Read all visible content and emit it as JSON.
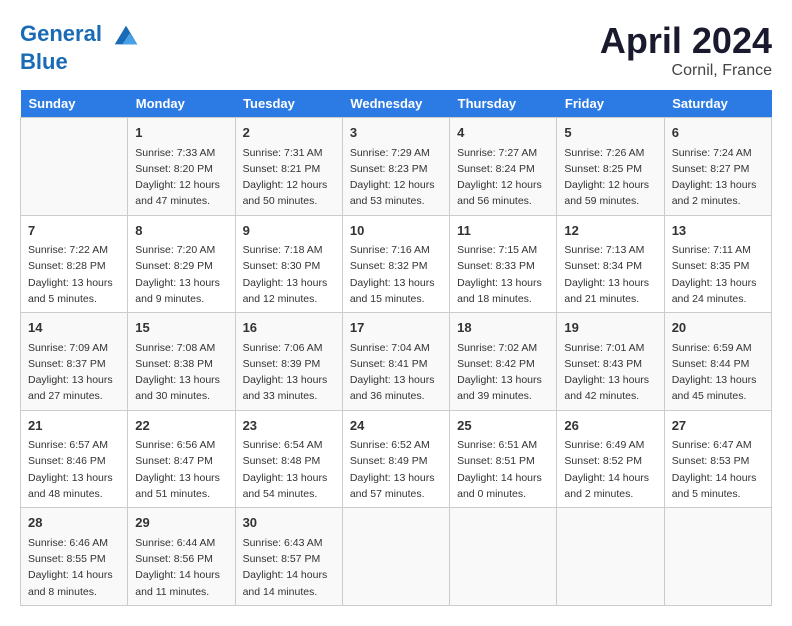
{
  "header": {
    "logo_line1": "General",
    "logo_line2": "Blue",
    "month": "April 2024",
    "location": "Cornil, France"
  },
  "days_of_week": [
    "Sunday",
    "Monday",
    "Tuesday",
    "Wednesday",
    "Thursday",
    "Friday",
    "Saturday"
  ],
  "weeks": [
    [
      {
        "day": "",
        "info": ""
      },
      {
        "day": "1",
        "info": "Sunrise: 7:33 AM\nSunset: 8:20 PM\nDaylight: 12 hours\nand 47 minutes."
      },
      {
        "day": "2",
        "info": "Sunrise: 7:31 AM\nSunset: 8:21 PM\nDaylight: 12 hours\nand 50 minutes."
      },
      {
        "day": "3",
        "info": "Sunrise: 7:29 AM\nSunset: 8:23 PM\nDaylight: 12 hours\nand 53 minutes."
      },
      {
        "day": "4",
        "info": "Sunrise: 7:27 AM\nSunset: 8:24 PM\nDaylight: 12 hours\nand 56 minutes."
      },
      {
        "day": "5",
        "info": "Sunrise: 7:26 AM\nSunset: 8:25 PM\nDaylight: 12 hours\nand 59 minutes."
      },
      {
        "day": "6",
        "info": "Sunrise: 7:24 AM\nSunset: 8:27 PM\nDaylight: 13 hours\nand 2 minutes."
      }
    ],
    [
      {
        "day": "7",
        "info": "Sunrise: 7:22 AM\nSunset: 8:28 PM\nDaylight: 13 hours\nand 5 minutes."
      },
      {
        "day": "8",
        "info": "Sunrise: 7:20 AM\nSunset: 8:29 PM\nDaylight: 13 hours\nand 9 minutes."
      },
      {
        "day": "9",
        "info": "Sunrise: 7:18 AM\nSunset: 8:30 PM\nDaylight: 13 hours\nand 12 minutes."
      },
      {
        "day": "10",
        "info": "Sunrise: 7:16 AM\nSunset: 8:32 PM\nDaylight: 13 hours\nand 15 minutes."
      },
      {
        "day": "11",
        "info": "Sunrise: 7:15 AM\nSunset: 8:33 PM\nDaylight: 13 hours\nand 18 minutes."
      },
      {
        "day": "12",
        "info": "Sunrise: 7:13 AM\nSunset: 8:34 PM\nDaylight: 13 hours\nand 21 minutes."
      },
      {
        "day": "13",
        "info": "Sunrise: 7:11 AM\nSunset: 8:35 PM\nDaylight: 13 hours\nand 24 minutes."
      }
    ],
    [
      {
        "day": "14",
        "info": "Sunrise: 7:09 AM\nSunset: 8:37 PM\nDaylight: 13 hours\nand 27 minutes."
      },
      {
        "day": "15",
        "info": "Sunrise: 7:08 AM\nSunset: 8:38 PM\nDaylight: 13 hours\nand 30 minutes."
      },
      {
        "day": "16",
        "info": "Sunrise: 7:06 AM\nSunset: 8:39 PM\nDaylight: 13 hours\nand 33 minutes."
      },
      {
        "day": "17",
        "info": "Sunrise: 7:04 AM\nSunset: 8:41 PM\nDaylight: 13 hours\nand 36 minutes."
      },
      {
        "day": "18",
        "info": "Sunrise: 7:02 AM\nSunset: 8:42 PM\nDaylight: 13 hours\nand 39 minutes."
      },
      {
        "day": "19",
        "info": "Sunrise: 7:01 AM\nSunset: 8:43 PM\nDaylight: 13 hours\nand 42 minutes."
      },
      {
        "day": "20",
        "info": "Sunrise: 6:59 AM\nSunset: 8:44 PM\nDaylight: 13 hours\nand 45 minutes."
      }
    ],
    [
      {
        "day": "21",
        "info": "Sunrise: 6:57 AM\nSunset: 8:46 PM\nDaylight: 13 hours\nand 48 minutes."
      },
      {
        "day": "22",
        "info": "Sunrise: 6:56 AM\nSunset: 8:47 PM\nDaylight: 13 hours\nand 51 minutes."
      },
      {
        "day": "23",
        "info": "Sunrise: 6:54 AM\nSunset: 8:48 PM\nDaylight: 13 hours\nand 54 minutes."
      },
      {
        "day": "24",
        "info": "Sunrise: 6:52 AM\nSunset: 8:49 PM\nDaylight: 13 hours\nand 57 minutes."
      },
      {
        "day": "25",
        "info": "Sunrise: 6:51 AM\nSunset: 8:51 PM\nDaylight: 14 hours\nand 0 minutes."
      },
      {
        "day": "26",
        "info": "Sunrise: 6:49 AM\nSunset: 8:52 PM\nDaylight: 14 hours\nand 2 minutes."
      },
      {
        "day": "27",
        "info": "Sunrise: 6:47 AM\nSunset: 8:53 PM\nDaylight: 14 hours\nand 5 minutes."
      }
    ],
    [
      {
        "day": "28",
        "info": "Sunrise: 6:46 AM\nSunset: 8:55 PM\nDaylight: 14 hours\nand 8 minutes."
      },
      {
        "day": "29",
        "info": "Sunrise: 6:44 AM\nSunset: 8:56 PM\nDaylight: 14 hours\nand 11 minutes."
      },
      {
        "day": "30",
        "info": "Sunrise: 6:43 AM\nSunset: 8:57 PM\nDaylight: 14 hours\nand 14 minutes."
      },
      {
        "day": "",
        "info": ""
      },
      {
        "day": "",
        "info": ""
      },
      {
        "day": "",
        "info": ""
      },
      {
        "day": "",
        "info": ""
      }
    ]
  ]
}
